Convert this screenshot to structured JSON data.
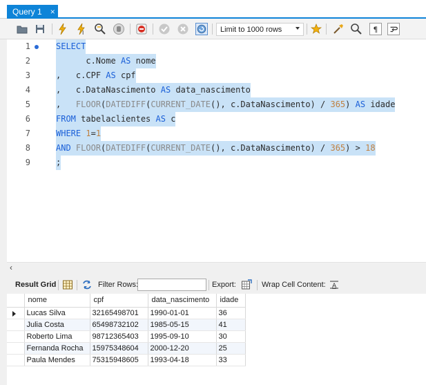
{
  "tab": {
    "title": "Query 1",
    "close": "×"
  },
  "toolbar": {
    "limit_select_value": "Limit to 1000 rows"
  },
  "editor": {
    "line_numbers": [
      "1",
      "2",
      "3",
      "4",
      "5",
      "6",
      "7",
      "8",
      "9"
    ],
    "lines": [
      "SELECT",
      "      c.Nome AS nome",
      ",   c.CPF AS cpf",
      ",   c.DataNascimento AS data_nascimento",
      ",   FLOOR(DATEDIFF(CURRENT_DATE(), c.DataNascimento) / 365) AS idade",
      "FROM tabelaclientes AS c",
      "WHERE 1=1",
      "AND FLOOR(DATEDIFF(CURRENT_DATE(), c.DataNascimento) / 365) > 18",
      ";"
    ]
  },
  "result_bar": {
    "result_grid_label": "Result Grid",
    "filter_rows_label": "Filter Rows:",
    "filter_rows_value": "",
    "export_label": "Export:",
    "wrap_label": "Wrap Cell Content:"
  },
  "grid": {
    "columns": [
      "nome",
      "cpf",
      "data_nascimento",
      "idade"
    ],
    "rows": [
      [
        "Lucas Silva",
        "32165498701",
        "1990-01-01",
        "36"
      ],
      [
        "Julia Costa",
        "65498732102",
        "1985-05-15",
        "41"
      ],
      [
        "Roberto Lima",
        "98712365403",
        "1995-09-10",
        "30"
      ],
      [
        "Fernanda Rocha",
        "15975348604",
        "2000-12-20",
        "25"
      ],
      [
        "Paula Mendes",
        "75315948605",
        "1993-04-18",
        "33"
      ]
    ]
  },
  "colors": {
    "accent": "#0e84d8",
    "selection": "#c9e2f7",
    "keyword": "#1a5fd8"
  }
}
